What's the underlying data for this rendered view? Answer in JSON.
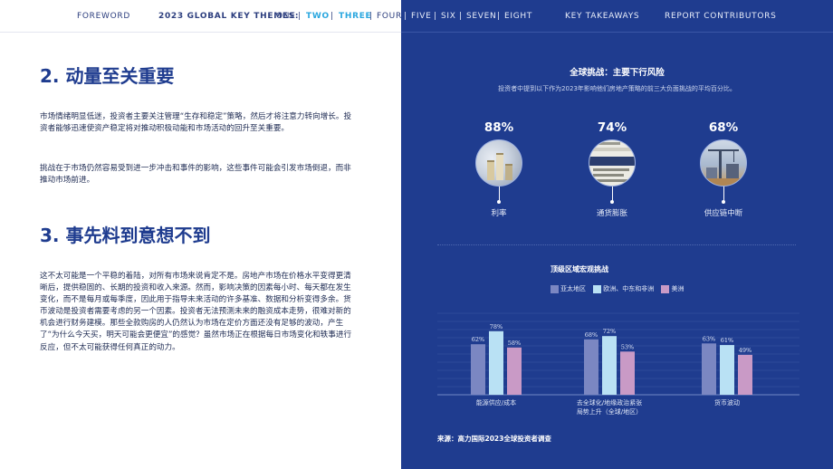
{
  "nav": {
    "foreword": "FOREWORD",
    "themes_label": "2023 GLOBAL KEY THEMES:",
    "one": "ONE",
    "two": "TWO",
    "three": "THREE",
    "four": "FOUR",
    "five": "FIVE",
    "six": "SIX",
    "seven": "SEVEN",
    "eight": "EIGHT",
    "key_takeaways": "KEY TAKEAWAYS",
    "contributors": "REPORT CONTRIBUTORS",
    "separator": "|"
  },
  "left": {
    "section2_title": "2. 动量至关重要",
    "section2_p1": "市场情绪明显低迷，投资者主要关注管理“生存和稳定”策略，然后才将注意力转向增长。投资者能够迅速使资产稳定将对推动积极动能和市场活动的回升至关重要。",
    "section2_p2": "挑战在于市场仍然容易受到进一步冲击和事件的影响，这些事件可能会引发市场倒退，而非推动市场前进。",
    "section3_title": "3. 事先料到意想不到",
    "section3_p1": "这不太可能是一个平稳的着陆，对所有市场来说肯定不是。房地产市场在价格水平变得更清晰后，提供稳固的、长期的投资和收入来源。然而，影响决策的因素每小时、每天都在发生变化，而不是每月或每季度，因此用于指导未来活动的许多基准、数据和分析变得多余。货币波动是投资者需要考虑的另一个因素。投资者无法预测未来的融资成本走势，很难对新的机会进行财务建模。那些全款购房的人仍然认为市场在定价方面还没有足够的波动，产生了“为什么今天买，明天可能会更便宜”的感觉？虽然市场正在根据每日市场变化和轶事进行反应，但不太可能获得任何真正的动力。"
  },
  "right": {
    "title": "全球挑战：主要下行风险",
    "subtitle": "投资者中提到以下作为2023年影响他们房地产策略的前三大负面挑战的平均百分比。",
    "stats": [
      {
        "pct": "88%",
        "label": "利率",
        "icon": "coin-stacks-image"
      },
      {
        "pct": "74%",
        "label": "通货膨胀",
        "icon": "inflation-newspaper-image"
      },
      {
        "pct": "68%",
        "label": "供应链中断",
        "icon": "construction-crane-image"
      }
    ],
    "source": "来源：高力国际2023全球投资者调查"
  },
  "colors": {
    "navy": "#1f3c8f",
    "accent": "#2aa7df",
    "series_apac": "#7b87c2",
    "series_emea": "#b9e1f4",
    "series_americas": "#c99ac6"
  },
  "chart_data": {
    "type": "bar",
    "title": "顶级区域宏观挑战",
    "categories": [
      "能源供应/成本",
      "去全球化/地缘政治紧张局势上升（全球/地区）",
      "货币波动"
    ],
    "category_lines": [
      [
        "能源供应/成本"
      ],
      [
        "去全球化/地缘政治紧张",
        "局势上升（全球/地区）"
      ],
      [
        "货币波动"
      ]
    ],
    "series": [
      {
        "name": "亚太地区",
        "values": [
          62,
          68,
          63
        ],
        "labels": [
          "62%",
          "68%",
          "63%"
        ]
      },
      {
        "name": "欧洲、中东和非洲",
        "values": [
          78,
          72,
          61
        ],
        "labels": [
          "78%",
          "72%",
          "61%"
        ]
      },
      {
        "name": "美洲",
        "values": [
          58,
          53,
          49
        ],
        "labels": [
          "58%",
          "53%",
          "49%"
        ]
      }
    ],
    "ylim": [
      0,
      100
    ],
    "grid": true,
    "legend": "top-left"
  }
}
